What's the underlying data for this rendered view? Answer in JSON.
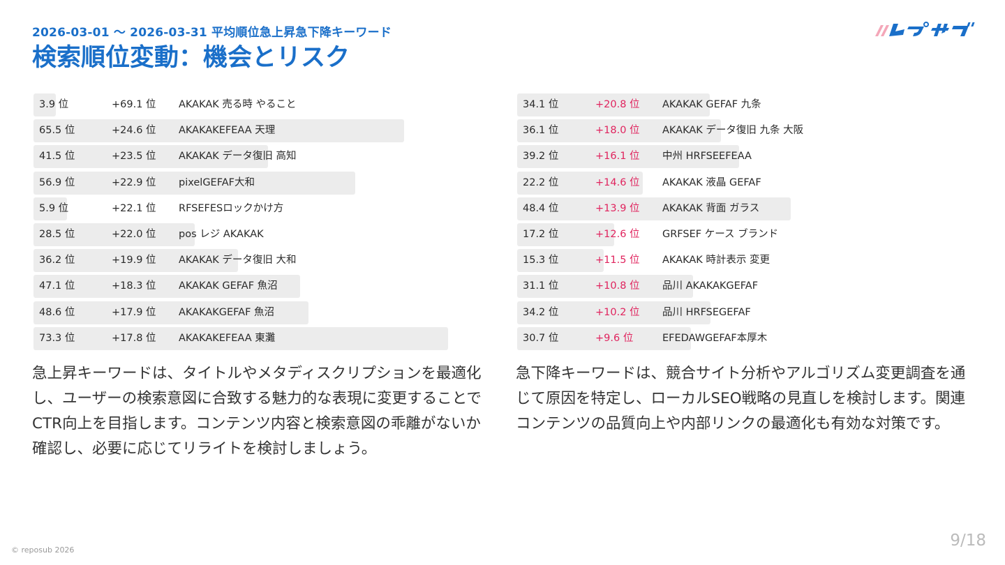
{
  "header": {
    "subtitle": "2026-03-01 〜 2026-03-31 平均順位急上昇急下降キーワード",
    "title": "検索順位変動：機会とリスク"
  },
  "brand": {
    "logo_name": "reposub-logo",
    "color": "#1a6fc9",
    "accent": "#f4a7b9"
  },
  "rising": {
    "rows": [
      {
        "rank": "3.9 位",
        "rank_value": 3.9,
        "delta": "+69.1 位",
        "keyword": "AKAKAK 売る時 やること"
      },
      {
        "rank": "65.5 位",
        "rank_value": 65.5,
        "delta": "+24.6 位",
        "keyword": "AKAKAKEFEAA 天理"
      },
      {
        "rank": "41.5 位",
        "rank_value": 41.5,
        "delta": "+23.5 位",
        "keyword": "AKAKAK データ復旧 高知"
      },
      {
        "rank": "56.9 位",
        "rank_value": 56.9,
        "delta": "+22.9 位",
        "keyword": "pixelGEFAF大和"
      },
      {
        "rank": "5.9 位",
        "rank_value": 5.9,
        "delta": "+22.1 位",
        "keyword": "RFSEFESロックかけ方"
      },
      {
        "rank": "28.5 位",
        "rank_value": 28.5,
        "delta": "+22.0 位",
        "keyword": "pos レジ AKAKAK"
      },
      {
        "rank": "36.2 位",
        "rank_value": 36.2,
        "delta": "+19.9 位",
        "keyword": "AKAKAK データ復旧 大和"
      },
      {
        "rank": "47.1 位",
        "rank_value": 47.1,
        "delta": "+18.3 位",
        "keyword": "AKAKAK GEFAF 魚沼"
      },
      {
        "rank": "48.6 位",
        "rank_value": 48.6,
        "delta": "+17.9 位",
        "keyword": "AKAKAKGEFAF 魚沼"
      },
      {
        "rank": "73.3 位",
        "rank_value": 73.3,
        "delta": "+17.8 位",
        "keyword": "AKAKAKEFEAA 東灘"
      }
    ],
    "description": "急上昇キーワードは、タイトルやメタディスクリプションを最適化し、ユーザーの検索意図に合致する魅力的な表現に変更することでCTR向上を目指します。コンテンツ内容と検索意図の乖離がないか確認し、必要に応じてリライトを検討しましょう。"
  },
  "falling": {
    "delta_color": "#e0245e",
    "rows": [
      {
        "rank": "34.1 位",
        "rank_value": 34.1,
        "delta": "+20.8 位",
        "keyword": "AKAKAK GEFAF 九条"
      },
      {
        "rank": "36.1 位",
        "rank_value": 36.1,
        "delta": "+18.0 位",
        "keyword": "AKAKAK データ復旧 九条 大阪"
      },
      {
        "rank": "39.2 位",
        "rank_value": 39.2,
        "delta": "+16.1 位",
        "keyword": "中州 HRFSEEFEAA"
      },
      {
        "rank": "22.2 位",
        "rank_value": 22.2,
        "delta": "+14.6 位",
        "keyword": "AKAKAK 液晶 GEFAF"
      },
      {
        "rank": "48.4 位",
        "rank_value": 48.4,
        "delta": "+13.9 位",
        "keyword": "AKAKAK 背面 ガラス"
      },
      {
        "rank": "17.2 位",
        "rank_value": 17.2,
        "delta": "+12.6 位",
        "keyword": "GRFSEF ケース ブランド"
      },
      {
        "rank": "15.3 位",
        "rank_value": 15.3,
        "delta": "+11.5 位",
        "keyword": "AKAKAK 時計表示 変更"
      },
      {
        "rank": "31.1 位",
        "rank_value": 31.1,
        "delta": "+10.8 位",
        "keyword": "品川 AKAKAKGEFAF"
      },
      {
        "rank": "34.2 位",
        "rank_value": 34.2,
        "delta": "+10.2 位",
        "keyword": "品川 HRFSEGEFAF"
      },
      {
        "rank": "30.7 位",
        "rank_value": 30.7,
        "delta": "+9.6 位",
        "keyword": "EFEDAWGEFAF本厚木"
      }
    ],
    "description": "急下降キーワードは、競合サイト分析やアルゴリズム変更調査を通じて原因を特定し、ローカルSEO戦略の見直しを検討します。関連コンテンツの品質向上や内部リンクの最適化も有効な対策です。"
  },
  "footer": {
    "copyright": "© reposub 2026",
    "page": "9/18"
  }
}
